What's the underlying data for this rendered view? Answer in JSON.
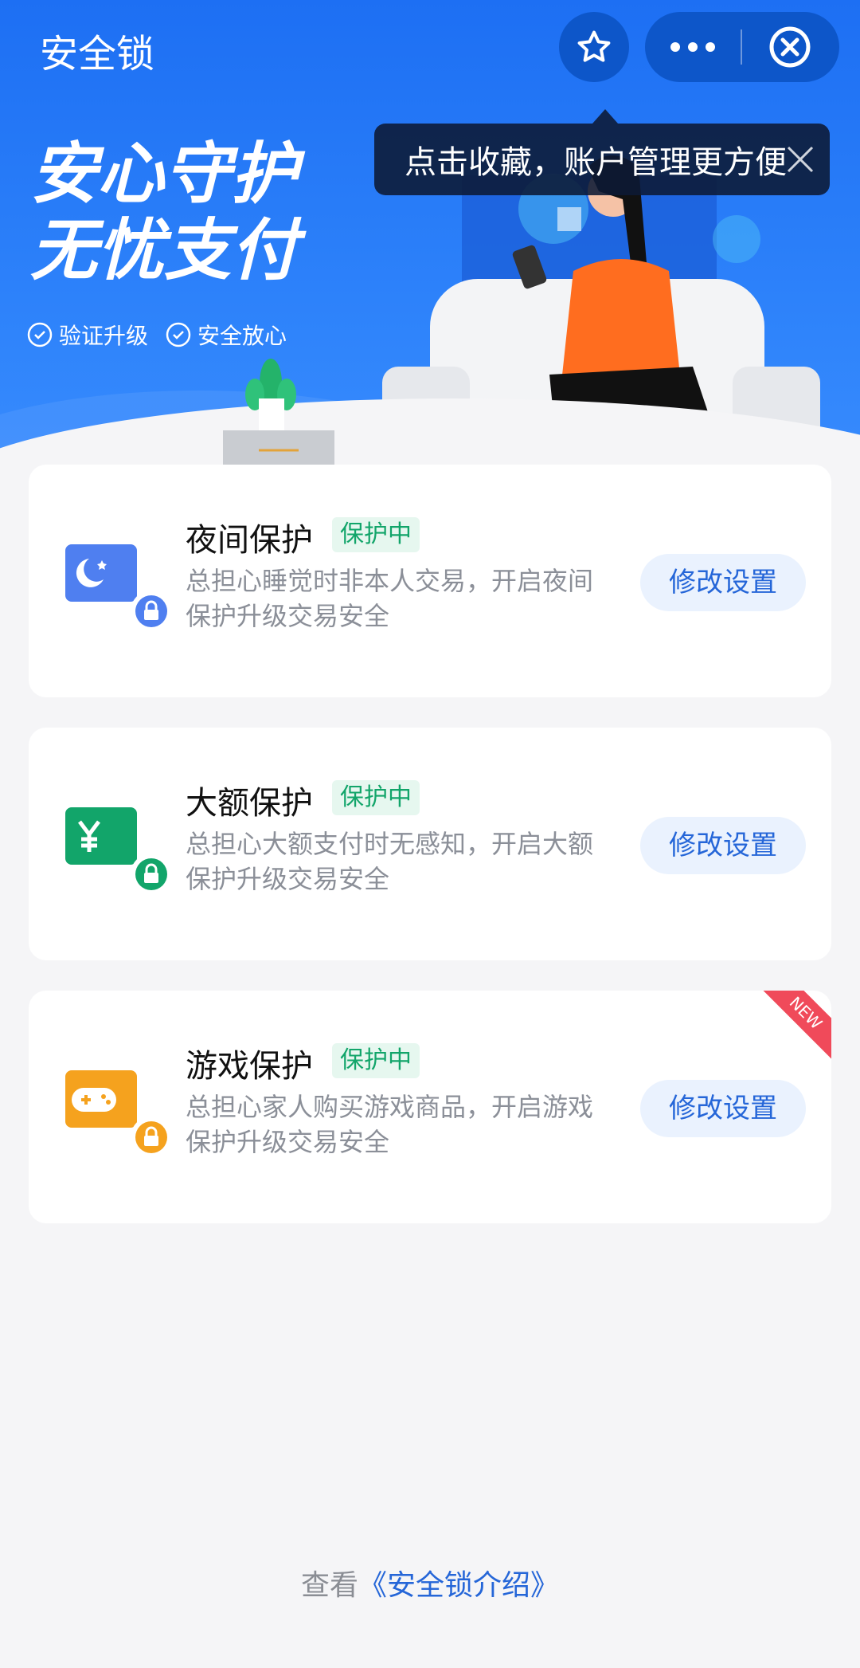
{
  "header": {
    "title": "安全锁"
  },
  "tooltip": {
    "text": "点击收藏，账户管理更方便"
  },
  "hero": {
    "slogan_line1": "安心守护",
    "slogan_line2": "无忧支付",
    "checks": [
      "验证升级",
      "安全放心"
    ]
  },
  "cards": [
    {
      "name": "夜间保护",
      "badge": "保护中",
      "desc": "总担心睡觉时非本人交易，开启夜间保护升级交易安全",
      "button": "修改设置"
    },
    {
      "name": "大额保护",
      "badge": "保护中",
      "desc": "总担心大额支付时无感知，开启大额保护升级交易安全",
      "button": "修改设置"
    },
    {
      "name": "游戏保护",
      "badge": "保护中",
      "desc": "总担心家人购买游戏商品，开启游戏保护升级交易安全",
      "button": "修改设置",
      "corner": "NEW"
    }
  ],
  "footer": {
    "prefix": "查看",
    "link": "《安全锁介绍》"
  },
  "colors": {
    "accent": "#2566d8",
    "hero_blue": "#1d6ff3",
    "night": "#4f7ff0",
    "amount": "#12a56a",
    "game": "#f5a21e",
    "badge_green": "#12a56a"
  },
  "icons": [
    "star-icon",
    "more-icon",
    "close-circle-icon",
    "close-icon",
    "check-circle-icon",
    "moon-icon",
    "yen-icon",
    "gamepad-icon",
    "lock-icon"
  ]
}
